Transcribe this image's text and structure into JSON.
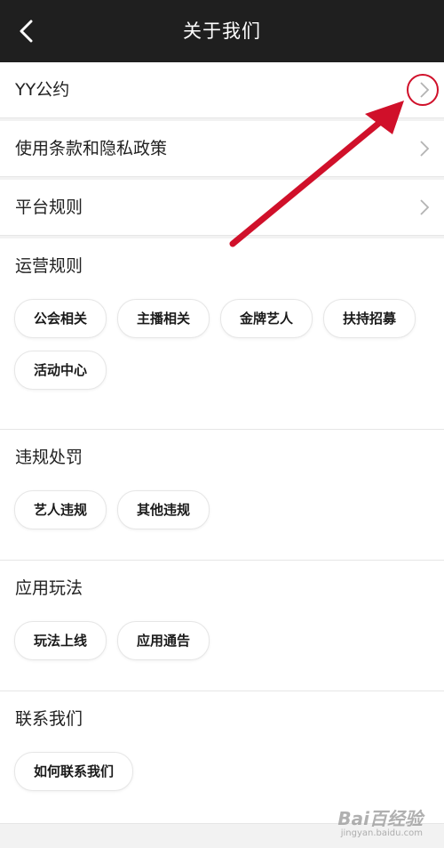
{
  "header": {
    "title": "关于我们",
    "back_icon": "chevron-left-icon"
  },
  "nav_rows": [
    {
      "label": "YY公约"
    },
    {
      "label": "使用条款和隐私政策"
    },
    {
      "label": "平台规则"
    }
  ],
  "sections": [
    {
      "title": "运营规则",
      "chips": [
        "公会相关",
        "主播相关",
        "金牌艺人",
        "扶持招募",
        "活动中心"
      ]
    },
    {
      "title": "违规处罚",
      "chips": [
        "艺人违规",
        "其他违规"
      ]
    },
    {
      "title": "应用玩法",
      "chips": [
        "玩法上线",
        "应用通告"
      ]
    },
    {
      "title": "联系我们",
      "chips": [
        "如何联系我们"
      ]
    }
  ],
  "annotation": {
    "color": "#d0102a"
  },
  "watermark": {
    "brand": "Bai百经验",
    "url": "jingyan.baidu.com"
  },
  "colors": {
    "header_bg": "#1f1f1f",
    "page_bg": "#f2f2f2",
    "card_bg": "#ffffff"
  }
}
